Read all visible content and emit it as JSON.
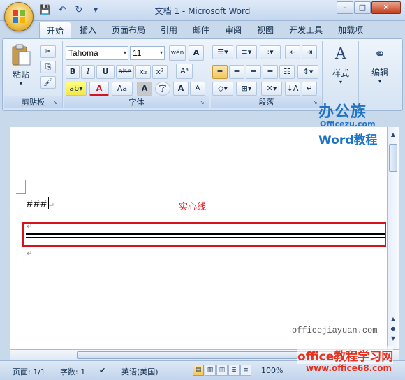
{
  "window": {
    "title": "文档 1 - Microsoft Word",
    "min": "–",
    "max": "□",
    "close": "✕"
  },
  "qat": {
    "save": "💾",
    "undo": "↶",
    "redo": "↻",
    "more": "▾"
  },
  "tabs": [
    "开始",
    "插入",
    "页面布局",
    "引用",
    "邮件",
    "审阅",
    "视图",
    "开发工具",
    "加载项"
  ],
  "ribbon": {
    "clipboard": {
      "label": "剪贴板",
      "paste": "粘贴"
    },
    "font": {
      "label": "字体",
      "font_name": "Tahoma",
      "font_size": "11",
      "bold": "B",
      "italic": "I",
      "underline": "U",
      "strike": "abe",
      "sub": "x₂",
      "sup": "x²",
      "font_color": "A",
      "change_case": "Aa",
      "char_shading": "A",
      "enclose": "字",
      "grow": "A",
      "shrink": "A",
      "pinyin": "wén",
      "char_border": "A"
    },
    "paragraph": {
      "label": "段落"
    },
    "styles": {
      "label": "样式"
    },
    "editing": {
      "label": "编辑"
    }
  },
  "document": {
    "line1": "###",
    "para": "↵",
    "annotation": "实心线"
  },
  "watermarks": {
    "brand": "办公族",
    "brand_sub": "Officezu.com",
    "brand_word": "Word教程",
    "site": "officejiayuan.com",
    "bottom1": "office教程学习网",
    "bottom2": "www.office68.com"
  },
  "statusbar": {
    "page": "页面: 1/1",
    "words": "字数: 1",
    "language": "英语(美国)",
    "zoom": "100%"
  }
}
